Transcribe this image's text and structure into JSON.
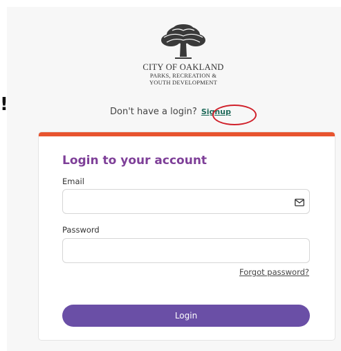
{
  "logo": {
    "line1": "CITY OF OAKLAND",
    "line2": "PARKS, RECREATION &",
    "line3": "YOUTH DEVELOPMENT"
  },
  "annotation": {
    "exclamation": "!"
  },
  "signup": {
    "prompt": "Don't have a login?",
    "link_label": "Signup"
  },
  "login_card": {
    "title": "Login to your account",
    "email_label": "Email",
    "email_value": "",
    "password_label": "Password",
    "password_value": "",
    "forgot_label": "Forgot password?",
    "login_button_label": "Login"
  },
  "icons": {
    "email_field_icon": "mail-icon",
    "logo": "oak-tree-icon"
  },
  "colors": {
    "accent_bar": "#e8542f",
    "title": "#7e3f98",
    "button": "#6a4fa6",
    "signup_link": "#1f6a5a",
    "highlight_circle": "#d0202a"
  }
}
